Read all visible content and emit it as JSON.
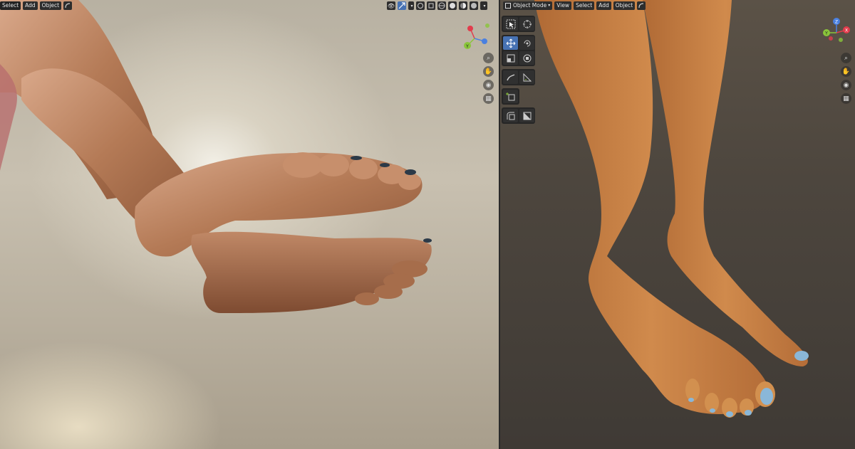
{
  "left_header": {
    "menu": [
      "Select",
      "Add",
      "Object"
    ],
    "right_icons": [
      "view-icon",
      "transform-icon",
      "overlay-icon",
      "xray-icon",
      "wireframe-shading-icon",
      "solid-shading-icon",
      "material-shading-icon",
      "rendered-shading-icon"
    ]
  },
  "right_header": {
    "mode_label": "Object Mode",
    "menu": [
      "View",
      "Select",
      "Add",
      "Object"
    ]
  },
  "gizmo": {
    "x_label": "X",
    "y_label": "Y",
    "z_label": "Z",
    "x_color": "#e23c4c",
    "y_color": "#8ac53a",
    "z_color": "#4a80e0"
  },
  "nav_icons": [
    "zoom-icon",
    "hand-pan-icon",
    "camera-icon",
    "grid-ortho-icon"
  ],
  "toolbar": {
    "groups": [
      [
        "select-box-icon",
        "cursor-icon"
      ],
      [
        "move-icon",
        "rotate-icon",
        "scale-icon",
        "transform-icon"
      ],
      [
        "annotate-icon",
        "measure-icon"
      ],
      [
        "add-cube-icon"
      ],
      [
        "shear-icon",
        "extrude-icon"
      ]
    ],
    "active_tool": "move-icon",
    "accent": "#4772b3"
  },
  "nail_color": "#8ab7d8"
}
